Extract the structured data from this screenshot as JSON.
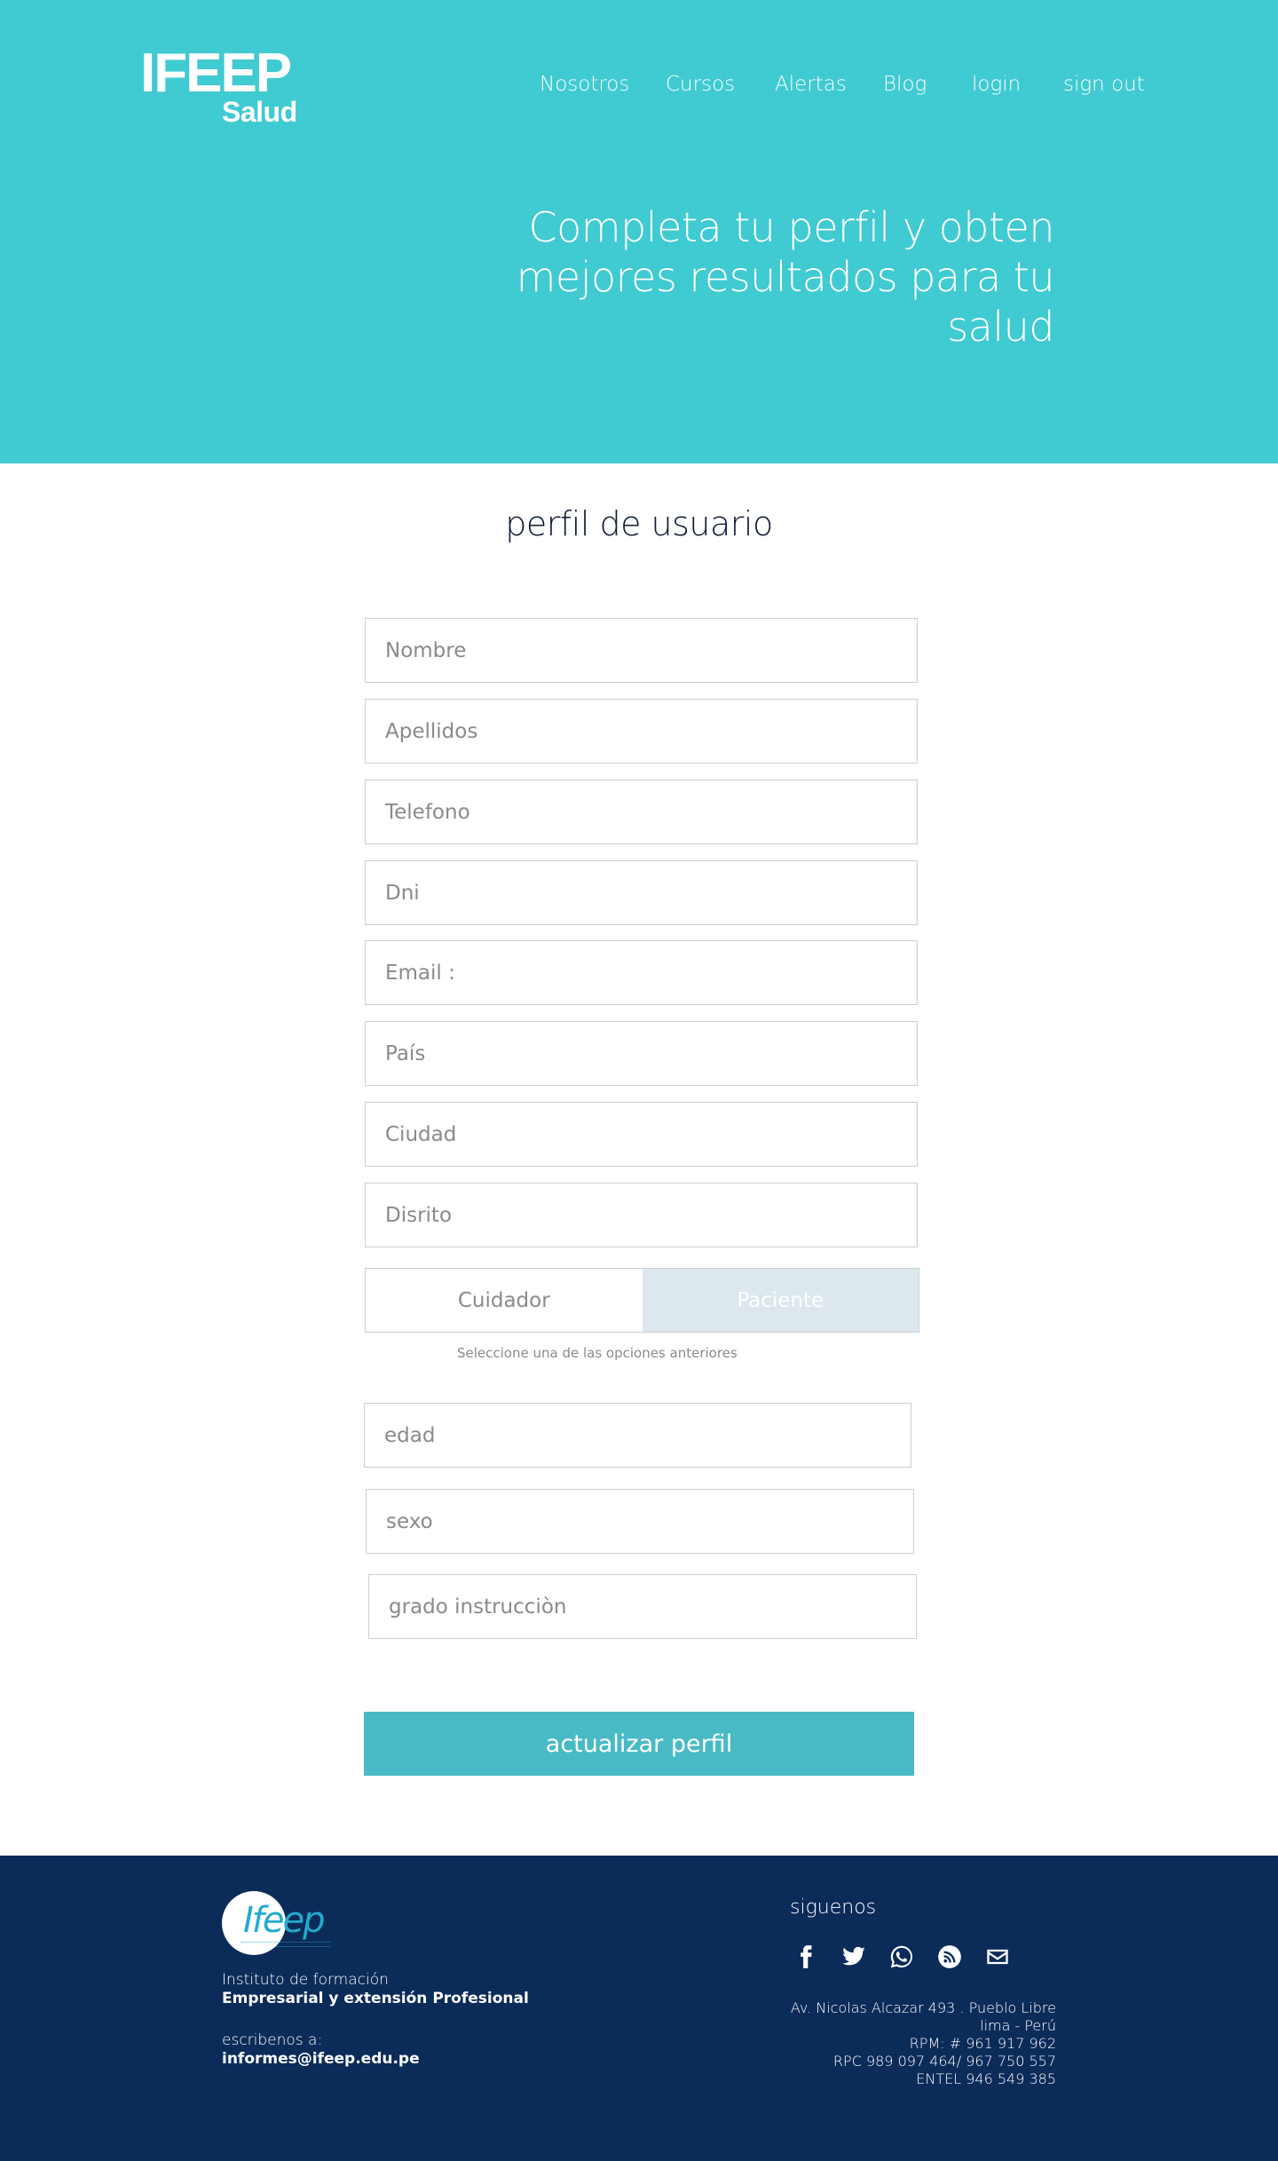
{
  "brand": {
    "name": "IFEEP",
    "sub": "Salud"
  },
  "nav": {
    "items": [
      "Nosotros",
      "Cursos",
      "Alertas",
      "Blog",
      "login",
      "sign out"
    ]
  },
  "hero": {
    "title_lines": [
      "Completa tu perfil y obten",
      "mejores resultados para tu",
      "salud"
    ]
  },
  "form": {
    "title": "perfil de usuario",
    "fields": {
      "nombre": "Nombre",
      "apellidos": "Apellidos",
      "telefono": "Telefono",
      "dni": "Dni",
      "email": "Email :",
      "pais": "País",
      "ciudad": "Ciudad",
      "distrito": "Disrito",
      "edad": "edad",
      "sexo": "sexo",
      "grado": "grado instrucciòn"
    },
    "toggle": {
      "option_1": "Cuidador",
      "option_2": "Paciente",
      "hint": "Seleccione una de las opciones anteriores"
    },
    "submit_label": "actualizar perfil"
  },
  "footer": {
    "logo_text": "Ifeep",
    "institute_line1": "Instituto de formación",
    "institute_line2": "Empresarial y extensión Profesional",
    "write_label": "escribenos a:",
    "email": "informes@ifeep.edu.pe",
    "follow_label": "siguenos",
    "social_icons": [
      "facebook-icon",
      "twitter-icon",
      "whatsapp-icon",
      "rss-icon",
      "mail-icon"
    ],
    "address": [
      "Av. Nicolas Alcazar 493 . Pueblo Libre",
      "lima - Perú",
      "RPM: # 961 917 962",
      "RPC 989 097 464/ 967 750 557",
      "ENTEL 946 549 385"
    ]
  },
  "colors": {
    "hero_bg": "#40cad1",
    "footer_bg": "#0b2b59",
    "button_bg": "#48bac5",
    "toggle_selected_bg": "#dce8ee"
  }
}
